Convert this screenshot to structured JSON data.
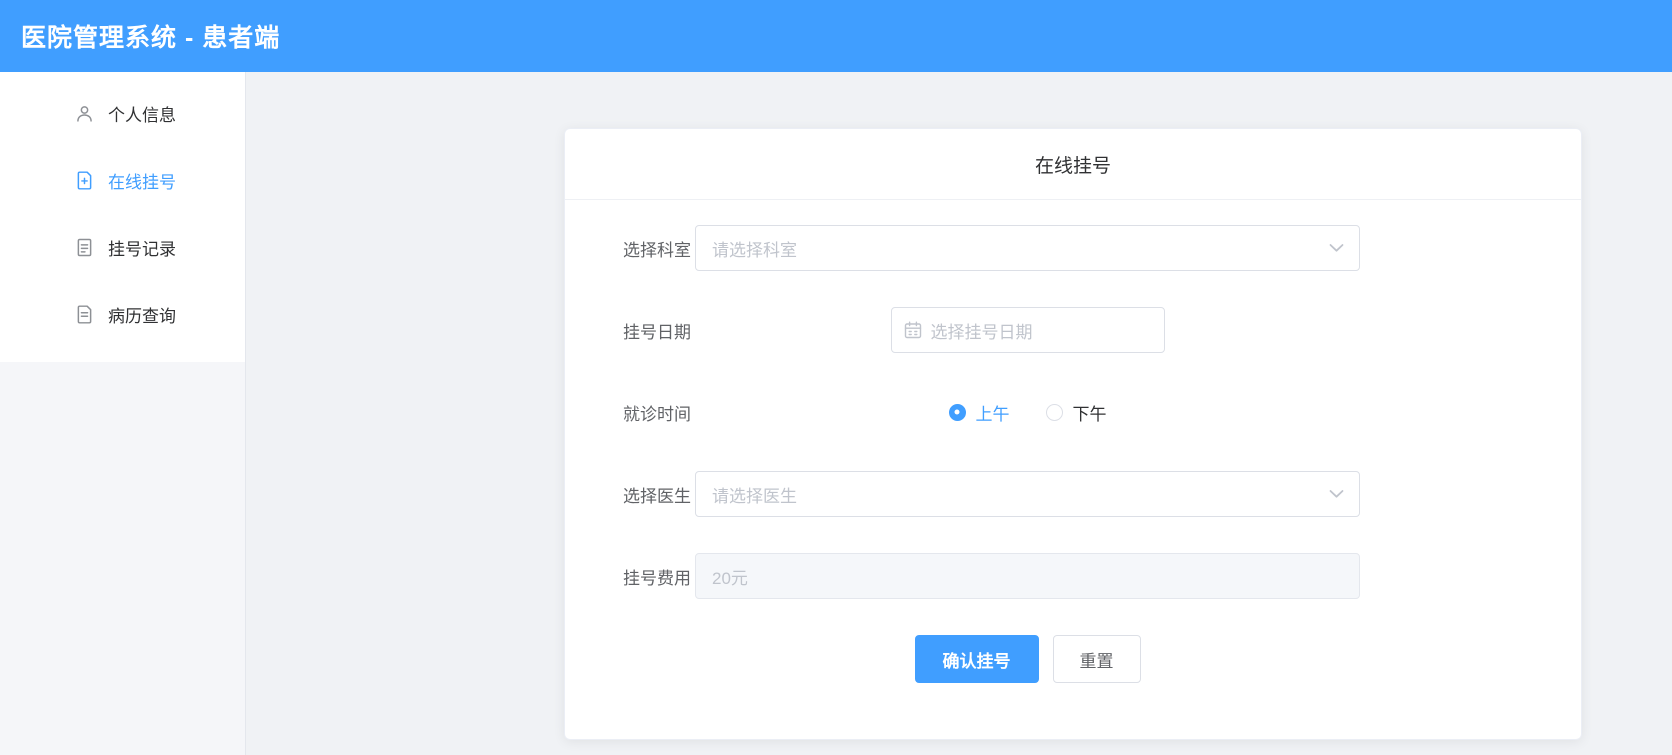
{
  "header": {
    "title": "医院管理系统 - 患者端"
  },
  "sidebar": {
    "items": [
      {
        "label": "个人信息",
        "icon": "user-icon",
        "active": false
      },
      {
        "label": "在线挂号",
        "icon": "document-add-icon",
        "active": true
      },
      {
        "label": "挂号记录",
        "icon": "document-list-icon",
        "active": false
      },
      {
        "label": "病历查询",
        "icon": "document-search-icon",
        "active": false
      }
    ]
  },
  "card": {
    "title": "在线挂号",
    "form": {
      "department": {
        "label": "选择科室",
        "placeholder": "请选择科室"
      },
      "date": {
        "label": "挂号日期",
        "placeholder": "选择挂号日期"
      },
      "time": {
        "label": "就诊时间",
        "options": [
          {
            "label": "上午",
            "selected": true
          },
          {
            "label": "下午",
            "selected": false
          }
        ]
      },
      "doctor": {
        "label": "选择医生",
        "placeholder": "请选择医生"
      },
      "fee": {
        "label": "挂号费用",
        "value": "20元",
        "disabled": true
      }
    },
    "buttons": {
      "confirm": "确认挂号",
      "reset": "重置"
    }
  },
  "colors": {
    "primary": "#409eff",
    "header_bg": "#409eff",
    "page_bg": "#f0f2f5",
    "placeholder": "#c0c4cc",
    "border": "#dcdfe6",
    "disabled_bg": "#f5f7fa"
  }
}
